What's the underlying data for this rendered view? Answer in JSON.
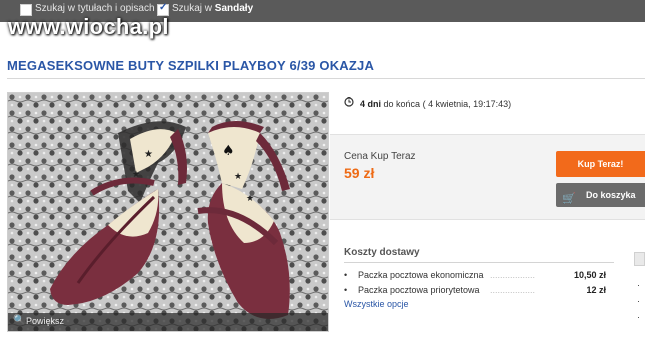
{
  "topbar": {
    "search_in_titles_label": "Szukaj w tytułach i opisach",
    "search_in_category_prefix": "Szukaj w ",
    "search_in_category_name": "Sandały"
  },
  "watermark": "www.wiocha.pl",
  "listing": {
    "title": "MEGASEKSOWNE BUTY SZPILKI PLAYBOY 6/39 OKAZJA"
  },
  "photo": {
    "zoom_label": "Powiększ"
  },
  "auction": {
    "days": "4 dni",
    "until_label": "do końca",
    "end_datetime": "( 4 kwietnia, 19:17:43)"
  },
  "buy": {
    "price_label": "Cena Kup Teraz",
    "price": "59 zł",
    "buy_now_label": "Kup Teraz!",
    "add_to_cart_label": "Do koszyka"
  },
  "shipping": {
    "heading": "Koszty dostawy",
    "options": [
      {
        "name": "Paczka pocztowa ekonomiczna",
        "price": "10,50 zł"
      },
      {
        "name": "Paczka pocztowa priorytetowa",
        "price": "12 zł"
      }
    ],
    "more_link": "Wszystkie opcje"
  },
  "colors": {
    "accent_orange": "#f26a1b",
    "title_blue": "#2a56a6",
    "topbar_gray": "#5a5a5a"
  }
}
